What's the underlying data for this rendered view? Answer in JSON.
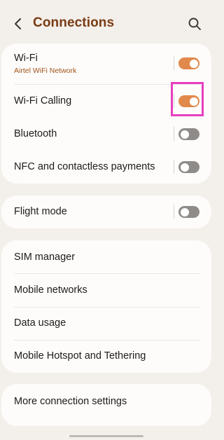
{
  "header": {
    "title": "Connections",
    "back_icon": "chevron-left-icon",
    "search_icon": "search-icon"
  },
  "colors": {
    "background": "#f3efea",
    "card": "#fdfcfb",
    "title": "#7a3b14",
    "subtitle": "#a2531a",
    "toggle_on": "#e1894c",
    "toggle_off": "#8f8b88",
    "highlight": "#e63fbf"
  },
  "groups": [
    {
      "items": [
        {
          "label": "Wi-Fi",
          "sublabel": "Airtel WiFi Network",
          "toggle": true
        },
        {
          "label": "Wi-Fi Calling",
          "toggle": true,
          "highlighted": true
        },
        {
          "label": "Bluetooth",
          "toggle": false
        },
        {
          "label": "NFC and contactless payments",
          "toggle": false
        }
      ]
    },
    {
      "items": [
        {
          "label": "Flight mode",
          "toggle": false
        }
      ]
    },
    {
      "items": [
        {
          "label": "SIM manager"
        },
        {
          "label": "Mobile networks"
        },
        {
          "label": "Data usage"
        },
        {
          "label": "Mobile Hotspot and Tethering"
        }
      ]
    },
    {
      "items": [
        {
          "label": "More connection settings"
        }
      ]
    }
  ]
}
